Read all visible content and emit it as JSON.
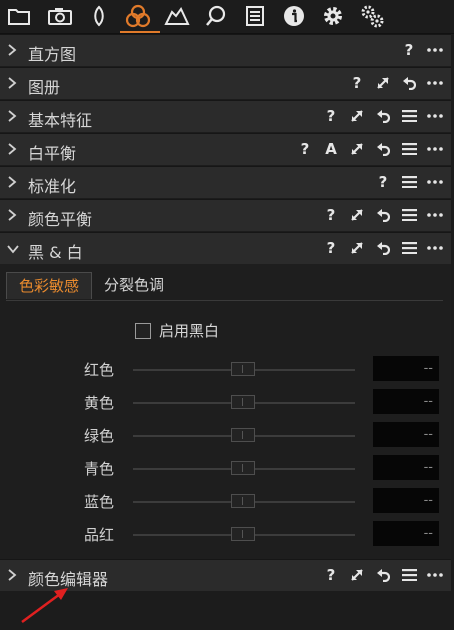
{
  "toolbar": {
    "icons": [
      "folder-icon",
      "camera-icon",
      "lens-icon",
      "color-icon",
      "exposure-icon",
      "search-icon",
      "list-icon",
      "info-icon",
      "gear-icon",
      "multi-gear-icon"
    ],
    "active_index": 3,
    "accent_color": "#e07a2a"
  },
  "panels": {
    "histogram": {
      "title": "直方图",
      "help": "?"
    },
    "album": {
      "title": "图册",
      "help": "?"
    },
    "basic": {
      "title": "基本特征",
      "help": "?"
    },
    "white_balance": {
      "title": "白平衡",
      "help": "?",
      "auto": "A"
    },
    "normalize": {
      "title": "标准化",
      "help": "?"
    },
    "color_balance": {
      "title": "颜色平衡",
      "help": "?"
    },
    "black_white": {
      "title": "黑 & 白",
      "help": "?"
    },
    "color_editor": {
      "title": "颜色编辑器",
      "help": "?"
    }
  },
  "bw": {
    "tabs": [
      "色彩敏感",
      "分裂色调"
    ],
    "active_tab": 0,
    "enable_label": "启用黑白",
    "enabled": false,
    "sliders": [
      {
        "label": "红色",
        "value": "--"
      },
      {
        "label": "黄色",
        "value": "--"
      },
      {
        "label": "绿色",
        "value": "--"
      },
      {
        "label": "青色",
        "value": "--"
      },
      {
        "label": "蓝色",
        "value": "--"
      },
      {
        "label": "品红",
        "value": "--"
      }
    ]
  },
  "annotation": {
    "arrow_color": "#e02020"
  }
}
